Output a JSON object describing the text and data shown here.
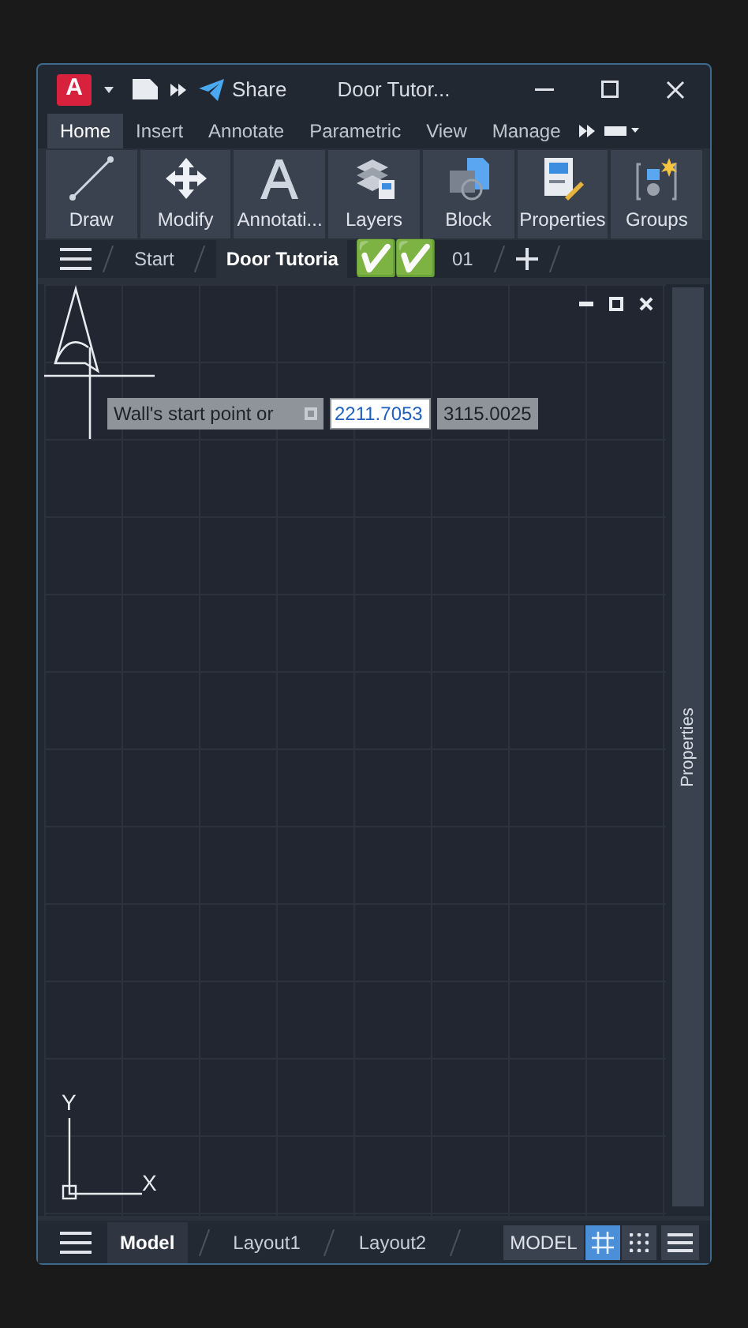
{
  "title_bar": {
    "app_letter": "A",
    "share": "Share",
    "title": "Door Tutor..."
  },
  "ribbon_tabs": [
    {
      "label": "Home",
      "selected": true
    },
    {
      "label": "Insert",
      "selected": false
    },
    {
      "label": "Annotate",
      "selected": false
    },
    {
      "label": "Parametric",
      "selected": false
    },
    {
      "label": "View",
      "selected": false
    },
    {
      "label": "Manage",
      "selected": false
    }
  ],
  "ribbon_panels": [
    {
      "kind": "draw",
      "label": "Draw"
    },
    {
      "kind": "modify",
      "label": "Modify"
    },
    {
      "kind": "annotation",
      "label": "Annotati..."
    },
    {
      "kind": "layers",
      "label": "Layers"
    },
    {
      "kind": "block",
      "label": "Block"
    },
    {
      "kind": "properties",
      "label": "Properties"
    },
    {
      "kind": "groups",
      "label": "Groups"
    }
  ],
  "doc_tabs": [
    {
      "label": "Start",
      "selected": false
    },
    {
      "label": "Door Tutoria",
      "selected": true
    },
    {
      "label": "01",
      "selected": false
    }
  ],
  "overlay_marks": [
    "✅",
    "✅"
  ],
  "prompt": {
    "label": "Wall's start point or",
    "x_value": "2211.7053",
    "y_value": "3115.0025"
  },
  "ucs": {
    "x": "X",
    "y": "Y"
  },
  "palette": {
    "label": "Properties"
  },
  "layout_tabs": [
    {
      "label": "Model",
      "selected": true
    },
    {
      "label": "Layout1",
      "selected": false
    },
    {
      "label": "Layout2",
      "selected": false
    }
  ],
  "status": {
    "space": "MODEL",
    "grid_on": true,
    "snap_on": false
  }
}
